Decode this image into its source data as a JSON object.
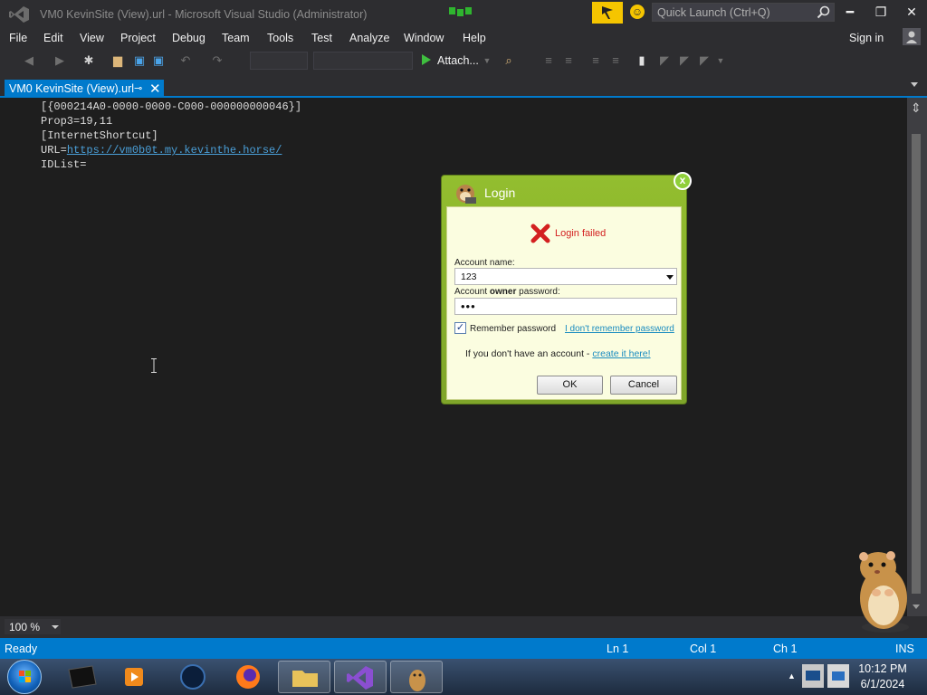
{
  "window": {
    "title": "VM0 KevinSite (View).url - Microsoft Visual Studio (Administrator)",
    "quick_launch_placeholder": "Quick Launch (Ctrl+Q)",
    "sign_in": "Sign in",
    "accent_color": "#007acc"
  },
  "menu": [
    "File",
    "Edit",
    "View",
    "Project",
    "Debug",
    "Team",
    "Tools",
    "Test",
    "Analyze",
    "Window",
    "Help"
  ],
  "toolbar": {
    "attach_label": "Attach...",
    "icons": [
      "back-icon",
      "forward-icon",
      "new-project-icon",
      "open-file-icon",
      "save-icon",
      "save-all-icon",
      "undo-icon",
      "redo-icon",
      "start-icon",
      "find-icon",
      "bookmark-icon"
    ]
  },
  "tab": {
    "label": "VM0 KevinSite (View).url",
    "pin": "⊸",
    "close": "✕"
  },
  "editor": {
    "lines": [
      "[{000214A0-0000-0000-C000-000000000046}]",
      "Prop3=19,11",
      "[InternetShortcut]",
      "URL="
    ],
    "url": "https://vm0b0t.my.kevinthe.horse/",
    "last_line": "IDList="
  },
  "zoom": {
    "level": "100 %"
  },
  "status": {
    "state": "Ready",
    "ln": "Ln 1",
    "col": "Col 1",
    "ch": "Ch 1",
    "mode": "INS"
  },
  "clock": {
    "time": "10:12 PM",
    "date": "6/1/2024"
  },
  "login": {
    "title": "Login",
    "close": "x",
    "error": "Login failed",
    "account_label": "Account name:",
    "account_value": "123",
    "password_label_pre": "Account ",
    "password_label_bold": "owner",
    "password_label_post": " password:",
    "password_value": "•••",
    "remember_label": "Remember password",
    "remember_checked": "✓",
    "forgot_link": "I don't remember password",
    "no_account_text": "If you don't have an account - ",
    "create_link": "create it here!",
    "ok": "OK",
    "cancel": "Cancel",
    "title_color": "#8ab52c",
    "error_color": "#d32020"
  }
}
